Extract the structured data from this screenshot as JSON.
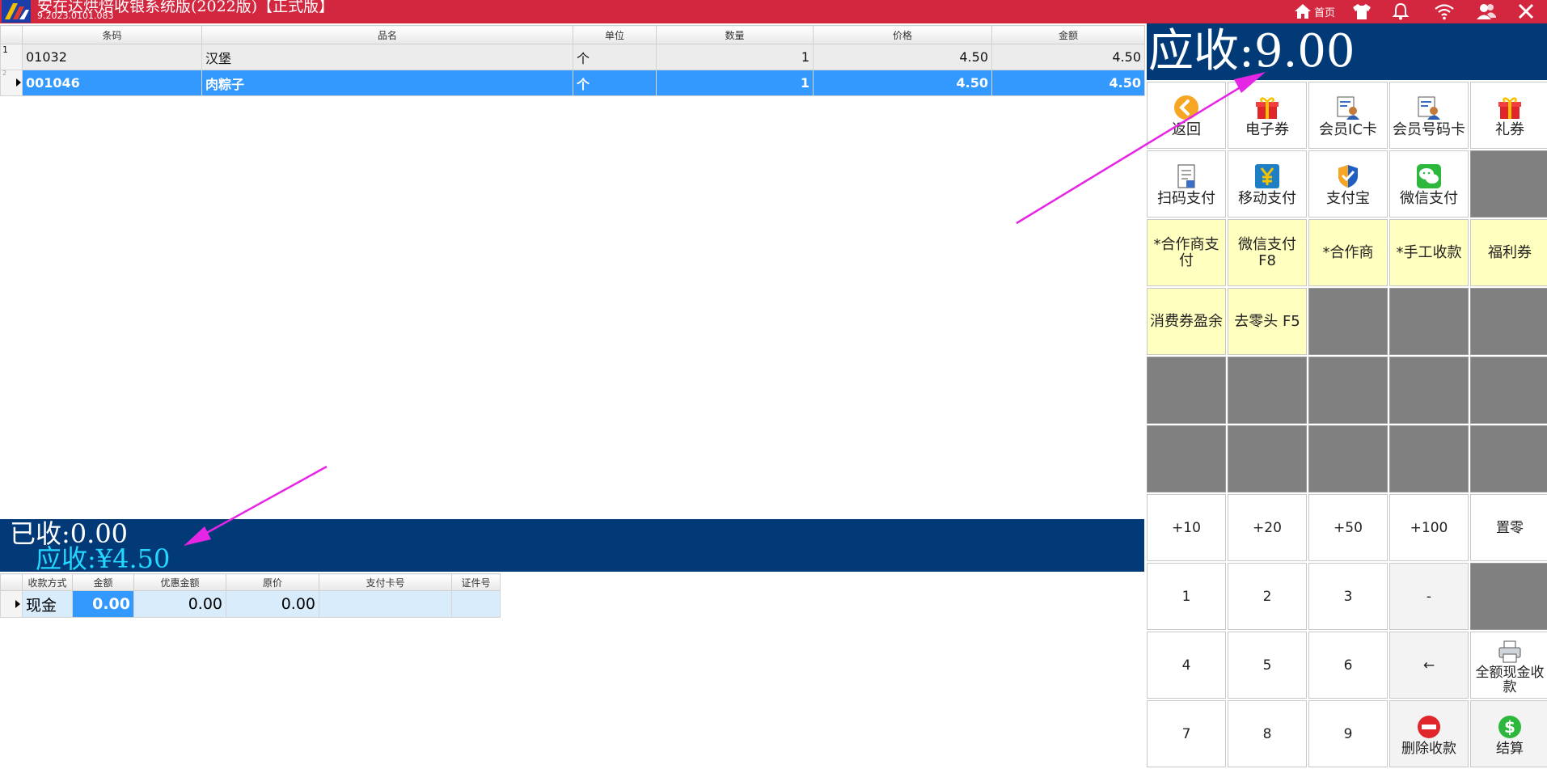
{
  "window": {
    "title": "安在达烘焙收银系统版(2022版)【正式版】",
    "version": "9.2023.0101.083",
    "home_label": "首页"
  },
  "items_table": {
    "headers": [
      "条码",
      "品名",
      "单位",
      "数量",
      "价格",
      "金额"
    ],
    "rows": [
      {
        "index": "1",
        "barcode": "01032",
        "name": "汉堡",
        "unit": "个",
        "qty": "1",
        "price": "4.50",
        "amount": "4.50"
      },
      {
        "index": "2",
        "barcode": "001046",
        "name": "肉粽子",
        "unit": "个",
        "qty": "1",
        "price": "4.50",
        "amount": "4.50"
      }
    ]
  },
  "summary": {
    "received": "已收:0.00",
    "due": "应收:¥4.50"
  },
  "payment_table": {
    "headers": [
      "收款方式",
      "金额",
      "优惠金额",
      "原价",
      "支付卡号",
      "证件号"
    ],
    "row": {
      "method": "现金",
      "amount": "0.00",
      "discount": "0.00",
      "original": "0.00",
      "card_no": "",
      "id_no": ""
    }
  },
  "due_header": "应收:9.00",
  "function_keys": {
    "back": "返回",
    "e_coupon": "电子券",
    "member_ic": "会员IC卡",
    "member_no": "会员号码卡",
    "gift_coupon": "礼券",
    "scan_pay": "扫码支付",
    "mobile_pay": "移动支付",
    "alipay": "支付宝",
    "wechat_pay": "微信支付",
    "partner_pay": "*合作商支\n付",
    "wechat_f8": "微信支付\nF8",
    "partner": "*合作商",
    "manual": "*手工收款",
    "welfare": "福利券",
    "voucher_surplus": "消费券盈余",
    "round_f5": "去零头 F5"
  },
  "numpad": {
    "plus10": "+10",
    "plus20": "+20",
    "plus50": "+50",
    "plus100": "+100",
    "zero_set": "置零",
    "k1": "1",
    "k2": "2",
    "k3": "3",
    "dash": "-",
    "k4": "4",
    "k5": "5",
    "k6": "6",
    "backspace": "←",
    "full_cash": "全额现金收\n款",
    "k7": "7",
    "k8": "8",
    "k9": "9",
    "delete_payment": "删除收款",
    "checkout": "结算"
  },
  "colors": {
    "title_bar": "#d3263f",
    "summary_bar": "#023a78",
    "selected_row": "#3399ff",
    "yellow_key": "#ffffbf",
    "gray_key": "#808080",
    "annotation_arrow": "#e526e5"
  }
}
